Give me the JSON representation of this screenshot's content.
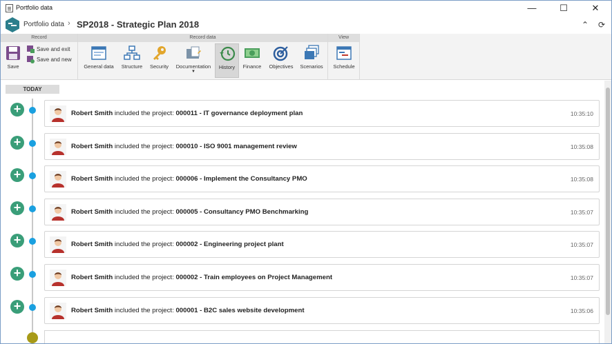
{
  "window": {
    "title": "Portfolio data",
    "minimize": "—",
    "maximize": "☐",
    "close": "✕"
  },
  "header": {
    "breadcrumb": "Portfolio data",
    "separator": "›",
    "title": "SP2018 - Strategic Plan 2018",
    "collapse_icon": "⌃",
    "refresh_icon": "⟳"
  },
  "ribbon": {
    "groups": {
      "record": "Record",
      "record_data": "Record data",
      "view": "View"
    },
    "save": "Save",
    "save_exit": "Save and exit",
    "save_new": "Save and new",
    "general_data": "General data",
    "structure": "Structure",
    "security": "Security",
    "documentation": "Documentation",
    "history": "History",
    "finance": "Finance",
    "objectives": "Objectives",
    "scenarios": "Scenarios",
    "schedule": "Schedule"
  },
  "timeline": {
    "today": "TODAY",
    "entries": [
      {
        "user": "Robert Smith",
        "action": " included the project: ",
        "project": "000011 - IT governance deployment plan",
        "time": "10:35:10"
      },
      {
        "user": "Robert Smith",
        "action": " included the project: ",
        "project": "000010 - ISO 9001 management review",
        "time": "10:35:08"
      },
      {
        "user": "Robert Smith",
        "action": " included the project: ",
        "project": "000006 - Implement the Consultancy PMO",
        "time": "10:35:08"
      },
      {
        "user": "Robert Smith",
        "action": " included the project: ",
        "project": "000005 - Consultancy PMO Benchmarking",
        "time": "10:35:07"
      },
      {
        "user": "Robert Smith",
        "action": " included the project: ",
        "project": "000002 - Engineering project plant",
        "time": "10:35:07"
      },
      {
        "user": "Robert Smith",
        "action": " included the project: ",
        "project": "000002 - Train employees on Project Management",
        "time": "10:35:07"
      },
      {
        "user": "Robert Smith",
        "action": " included the project: ",
        "project": "000001 - B2C sales website development",
        "time": "10:35:06"
      }
    ]
  },
  "colors": {
    "accent_green": "#3a9e79",
    "dot_blue": "#1aa0e0",
    "logo_teal": "#2b7e8c"
  }
}
